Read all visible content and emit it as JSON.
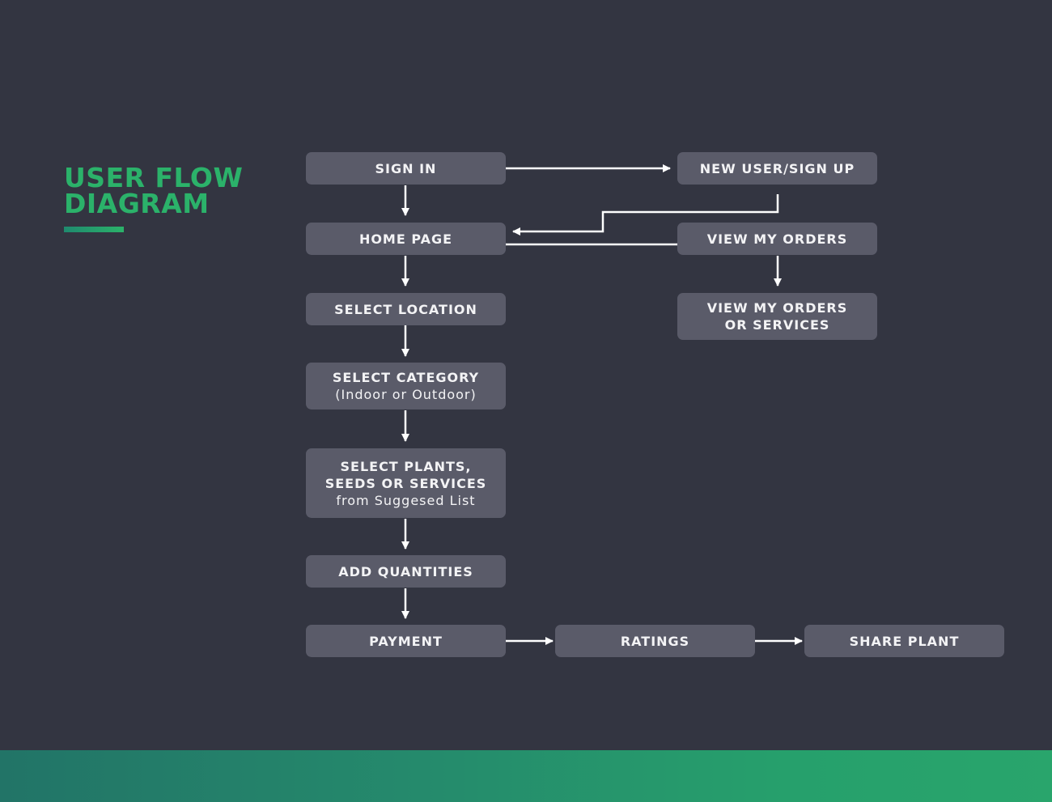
{
  "title": {
    "line1": "USER FLOW",
    "line2": "DIAGRAM"
  },
  "colors": {
    "background": "#333541",
    "node": "#5a5b69",
    "accent": "#2bb26a",
    "text": "#f3f3f5"
  },
  "nodes": {
    "sign_in": {
      "label": "SIGN IN"
    },
    "new_user": {
      "label": "NEW USER/SIGN UP"
    },
    "home_page": {
      "label": "HOME PAGE"
    },
    "view_orders": {
      "label": "VIEW MY ORDERS"
    },
    "select_location": {
      "label": "SELECT LOCATION"
    },
    "view_orders_services": {
      "label": "VIEW MY ORDERS OR SERVICES"
    },
    "select_category": {
      "label": "SELECT CATEGORY",
      "sub": "(Indoor or Outdoor)"
    },
    "select_plants": {
      "label1": "SELECT PLANTS,",
      "label2": "SEEDS OR SERVICES",
      "sub": "from Suggesed List"
    },
    "add_quantities": {
      "label": "ADD QUANTITIES"
    },
    "payment": {
      "label": "PAYMENT"
    },
    "ratings": {
      "label": "RATINGS"
    },
    "share_plant": {
      "label": "SHARE PLANT"
    }
  },
  "edges": [
    {
      "from": "sign_in",
      "to": "new_user"
    },
    {
      "from": "sign_in",
      "to": "home_page"
    },
    {
      "from": "new_user",
      "to": "home_page"
    },
    {
      "from": "view_orders",
      "to": "home_page",
      "style": "line"
    },
    {
      "from": "view_orders",
      "to": "view_orders_services"
    },
    {
      "from": "home_page",
      "to": "select_location"
    },
    {
      "from": "select_location",
      "to": "select_category"
    },
    {
      "from": "select_category",
      "to": "select_plants"
    },
    {
      "from": "select_plants",
      "to": "add_quantities"
    },
    {
      "from": "add_quantities",
      "to": "payment"
    },
    {
      "from": "payment",
      "to": "ratings"
    },
    {
      "from": "ratings",
      "to": "share_plant"
    }
  ]
}
